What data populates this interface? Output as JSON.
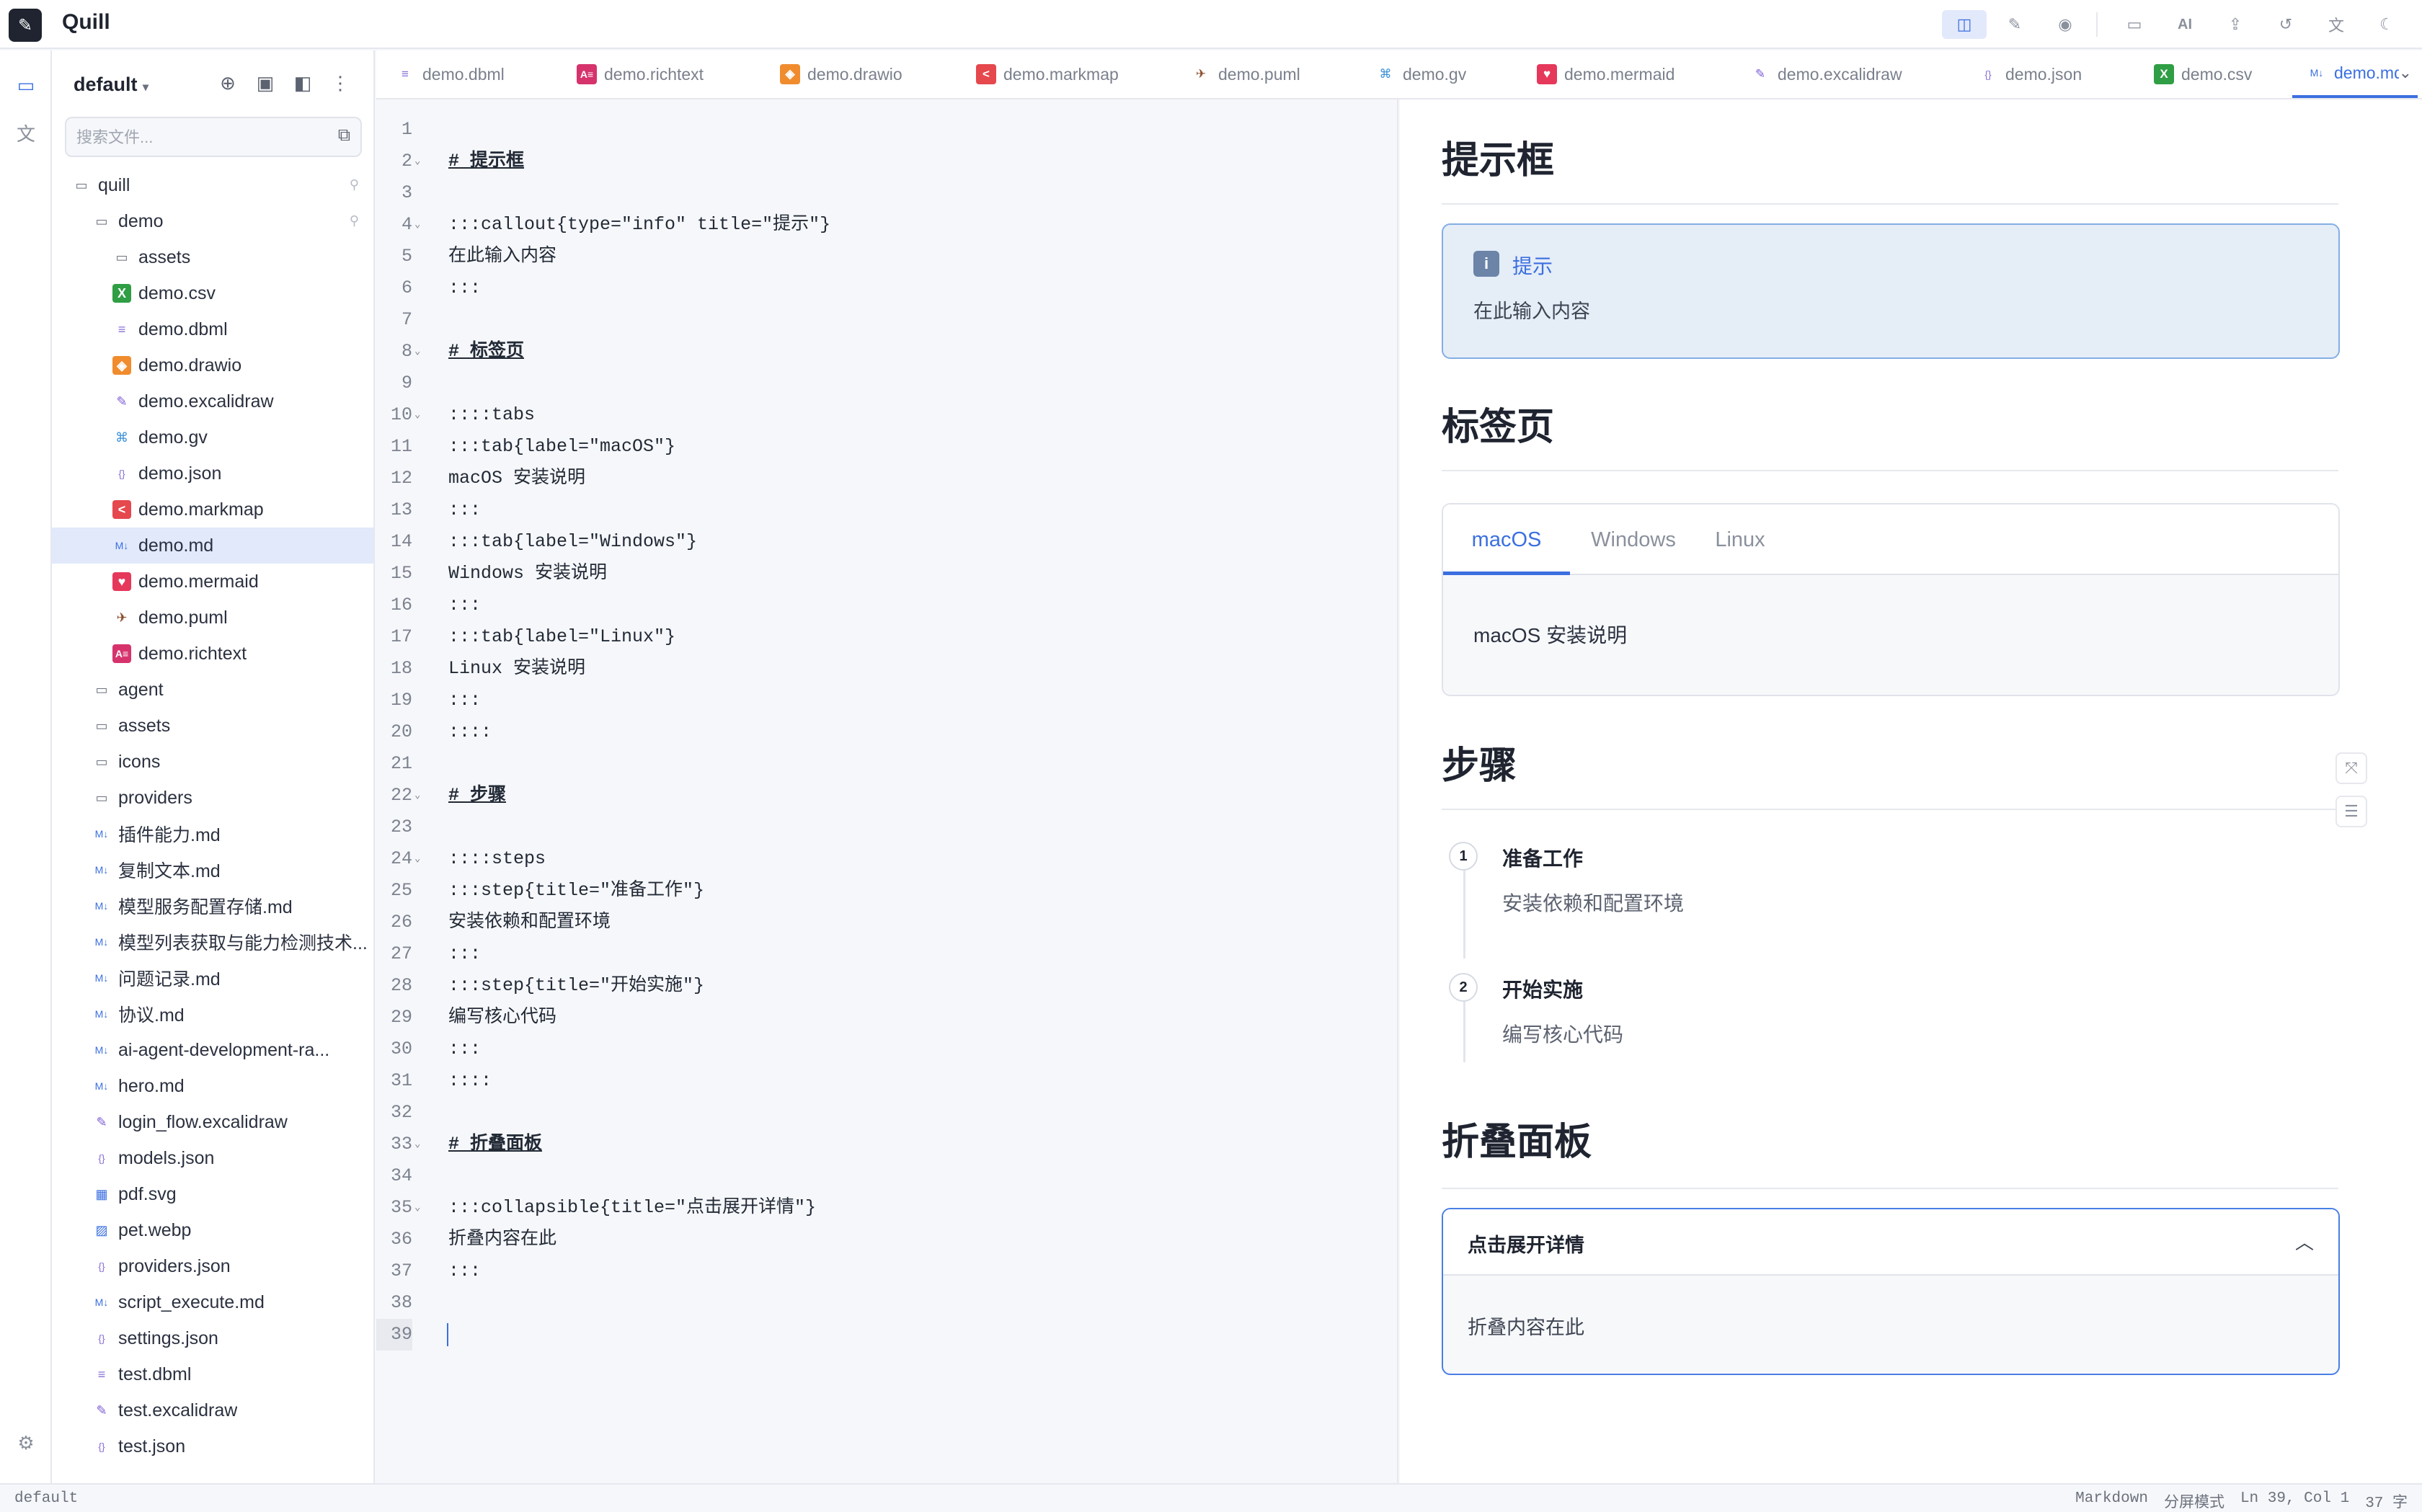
{
  "app": {
    "title": "Quill"
  },
  "sidebar": {
    "workspace": "default",
    "search_placeholder": "搜索文件...",
    "items": [
      {
        "label": "quill",
        "icon": "folder-icon",
        "indent": 0,
        "pinned": true
      },
      {
        "label": "demo",
        "icon": "folder-icon",
        "indent": 1,
        "pinned": true
      },
      {
        "label": "assets",
        "icon": "folder-icon",
        "indent": 2
      },
      {
        "label": "demo.csv",
        "icon": "csv-icon",
        "indent": 2
      },
      {
        "label": "demo.dbml",
        "icon": "database-icon",
        "indent": 2
      },
      {
        "label": "demo.drawio",
        "icon": "drawio-icon",
        "indent": 2
      },
      {
        "label": "demo.excalidraw",
        "icon": "pencil-icon",
        "indent": 2
      },
      {
        "label": "demo.gv",
        "icon": "graphviz-icon",
        "indent": 2
      },
      {
        "label": "demo.json",
        "icon": "json-icon",
        "indent": 2
      },
      {
        "label": "demo.markmap",
        "icon": "markmap-icon",
        "indent": 2
      },
      {
        "label": "demo.md",
        "icon": "markdown-icon",
        "indent": 2,
        "selected": true
      },
      {
        "label": "demo.mermaid",
        "icon": "mermaid-icon",
        "indent": 2
      },
      {
        "label": "demo.puml",
        "icon": "plantuml-icon",
        "indent": 2
      },
      {
        "label": "demo.richtext",
        "icon": "richtext-icon",
        "indent": 2
      },
      {
        "label": "agent",
        "icon": "folder-icon",
        "indent": 1
      },
      {
        "label": "assets",
        "icon": "folder-icon",
        "indent": 1
      },
      {
        "label": "icons",
        "icon": "folder-icon",
        "indent": 1
      },
      {
        "label": "providers",
        "icon": "folder-icon",
        "indent": 1
      },
      {
        "label": "插件能力.md",
        "icon": "markdown-icon",
        "indent": 1
      },
      {
        "label": "复制文本.md",
        "icon": "markdown-icon",
        "indent": 1
      },
      {
        "label": "模型服务配置存储.md",
        "icon": "markdown-icon",
        "indent": 1
      },
      {
        "label": "模型列表获取与能力检测技术...",
        "icon": "markdown-icon",
        "indent": 1
      },
      {
        "label": "问题记录.md",
        "icon": "markdown-icon",
        "indent": 1
      },
      {
        "label": "协议.md",
        "icon": "markdown-icon",
        "indent": 1
      },
      {
        "label": "ai-agent-development-ra...",
        "icon": "markdown-icon",
        "indent": 1
      },
      {
        "label": "hero.md",
        "icon": "markdown-icon",
        "indent": 1
      },
      {
        "label": "login_flow.excalidraw",
        "icon": "pencil-icon",
        "indent": 1
      },
      {
        "label": "models.json",
        "icon": "json-icon",
        "indent": 1
      },
      {
        "label": "pdf.svg",
        "icon": "svg-icon",
        "indent": 1
      },
      {
        "label": "pet.webp",
        "icon": "image-icon",
        "indent": 1
      },
      {
        "label": "providers.json",
        "icon": "json-icon",
        "indent": 1
      },
      {
        "label": "script_execute.md",
        "icon": "markdown-icon",
        "indent": 1
      },
      {
        "label": "settings.json",
        "icon": "json-icon",
        "indent": 1
      },
      {
        "label": "test.dbml",
        "icon": "database-icon",
        "indent": 1
      },
      {
        "label": "test.excalidraw",
        "icon": "pencil-icon",
        "indent": 1
      },
      {
        "label": "test.json",
        "icon": "json-icon",
        "indent": 1
      }
    ]
  },
  "tabs": [
    {
      "label": "demo.dbml",
      "icon": "database-icon"
    },
    {
      "label": "demo.richtext",
      "icon": "richtext-icon"
    },
    {
      "label": "demo.drawio",
      "icon": "drawio-icon"
    },
    {
      "label": "demo.markmap",
      "icon": "markmap-icon"
    },
    {
      "label": "demo.puml",
      "icon": "plantuml-icon"
    },
    {
      "label": "demo.gv",
      "icon": "graphviz-icon"
    },
    {
      "label": "demo.mermaid",
      "icon": "mermaid-icon"
    },
    {
      "label": "demo.excalidraw",
      "icon": "pencil-icon"
    },
    {
      "label": "demo.json",
      "icon": "json-icon"
    },
    {
      "label": "demo.csv",
      "icon": "csv-icon"
    },
    {
      "label": "demo.md",
      "icon": "markdown-icon",
      "active": true
    }
  ],
  "editor": {
    "lines": [
      {
        "n": "1",
        "text": ""
      },
      {
        "n": "2",
        "text": "# 提示框",
        "heading": true,
        "fold": true
      },
      {
        "n": "3",
        "text": ""
      },
      {
        "n": "4",
        "text": ":::callout{type=\"info\" title=\"提示\"}",
        "fold": true
      },
      {
        "n": "5",
        "text": "在此输入内容"
      },
      {
        "n": "6",
        "text": ":::"
      },
      {
        "n": "7",
        "text": ""
      },
      {
        "n": "8",
        "text": "# 标签页",
        "heading": true,
        "fold": true
      },
      {
        "n": "9",
        "text": ""
      },
      {
        "n": "10",
        "text": "::::tabs",
        "fold": true
      },
      {
        "n": "11",
        "text": ":::tab{label=\"macOS\"}"
      },
      {
        "n": "12",
        "text": "macOS 安装说明"
      },
      {
        "n": "13",
        "text": ":::"
      },
      {
        "n": "14",
        "text": ":::tab{label=\"Windows\"}"
      },
      {
        "n": "15",
        "text": "Windows 安装说明"
      },
      {
        "n": "16",
        "text": ":::"
      },
      {
        "n": "17",
        "text": ":::tab{label=\"Linux\"}"
      },
      {
        "n": "18",
        "text": "Linux 安装说明"
      },
      {
        "n": "19",
        "text": ":::"
      },
      {
        "n": "20",
        "text": "::::"
      },
      {
        "n": "21",
        "text": ""
      },
      {
        "n": "22",
        "text": "# 步骤",
        "heading": true,
        "fold": true
      },
      {
        "n": "23",
        "text": ""
      },
      {
        "n": "24",
        "text": "::::steps",
        "fold": true
      },
      {
        "n": "25",
        "text": ":::step{title=\"准备工作\"}"
      },
      {
        "n": "26",
        "text": "安装依赖和配置环境"
      },
      {
        "n": "27",
        "text": ":::"
      },
      {
        "n": "28",
        "text": ":::step{title=\"开始实施\"}"
      },
      {
        "n": "29",
        "text": "编写核心代码"
      },
      {
        "n": "30",
        "text": ":::"
      },
      {
        "n": "31",
        "text": "::::"
      },
      {
        "n": "32",
        "text": ""
      },
      {
        "n": "33",
        "text": "# 折叠面板",
        "heading": true,
        "fold": true
      },
      {
        "n": "34",
        "text": ""
      },
      {
        "n": "35",
        "text": ":::collapsible{title=\"点击展开详情\"}",
        "fold": true
      },
      {
        "n": "36",
        "text": "折叠内容在此"
      },
      {
        "n": "37",
        "text": ":::"
      },
      {
        "n": "38",
        "text": ""
      },
      {
        "n": "39",
        "text": "",
        "current": true
      }
    ]
  },
  "preview": {
    "callout": {
      "heading": "提示框",
      "title": "提示",
      "body": "在此输入内容",
      "icon_text": "i"
    },
    "tabs": {
      "heading": "标签页",
      "items": [
        "macOS",
        "Windows",
        "Linux"
      ],
      "active": 0,
      "body": "macOS 安装说明"
    },
    "steps": {
      "heading": "步骤",
      "items": [
        {
          "num": "1",
          "title": "准备工作",
          "desc": "安装依赖和配置环境"
        },
        {
          "num": "2",
          "title": "开始实施",
          "desc": "编写核心代码"
        }
      ]
    },
    "collapsible": {
      "heading": "折叠面板",
      "title": "点击展开详情",
      "body": "折叠内容在此"
    }
  },
  "status": {
    "left": "default",
    "language": "Markdown",
    "mode": "分屏模式",
    "position": "Ln 39, Col 1",
    "count": "37 字"
  },
  "toolbar": {
    "ai_label": "AI"
  },
  "colors": {
    "accent": "#3b6fe0",
    "selected_row": "#e1e9fb",
    "callout_bg": "#e5edf7"
  }
}
